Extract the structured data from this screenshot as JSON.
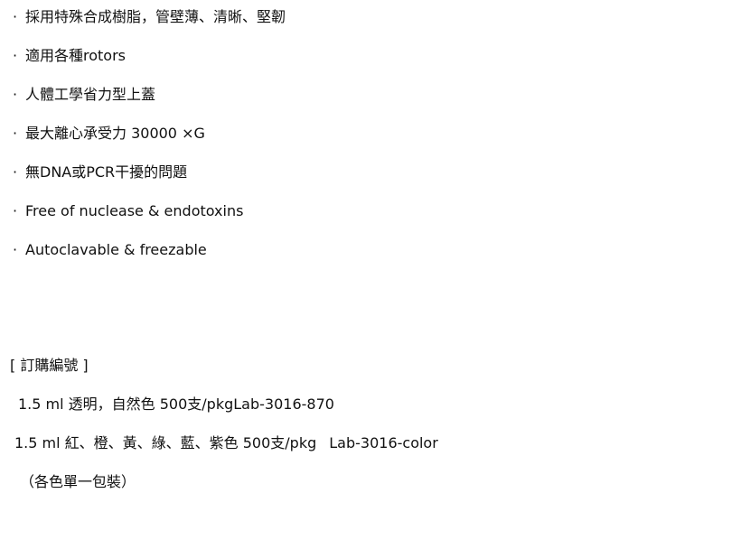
{
  "features": {
    "bullet": "·",
    "items": [
      "採用特殊合成樹脂，管壁薄、清晰、堅韌",
      "適用各種rotors",
      "人體工學省力型上蓋",
      "最大離心承受力 30000 ×G",
      "無DNA或PCR干擾的問題",
      "Free of nuclease & endotoxins",
      "Autoclavable & freezable"
    ]
  },
  "ordering": {
    "title": "[ 訂購編號 ]",
    "lines": [
      {
        "description": "1.5 ml 透明，自然色 500支/pkg",
        "code": "Lab-3016-870"
      },
      {
        "description": "1.5 ml 紅、橙、黃、綠、藍、紫色 500支/pkg",
        "code": "Lab-3016-color"
      }
    ],
    "note": "（各色單一包裝）"
  }
}
